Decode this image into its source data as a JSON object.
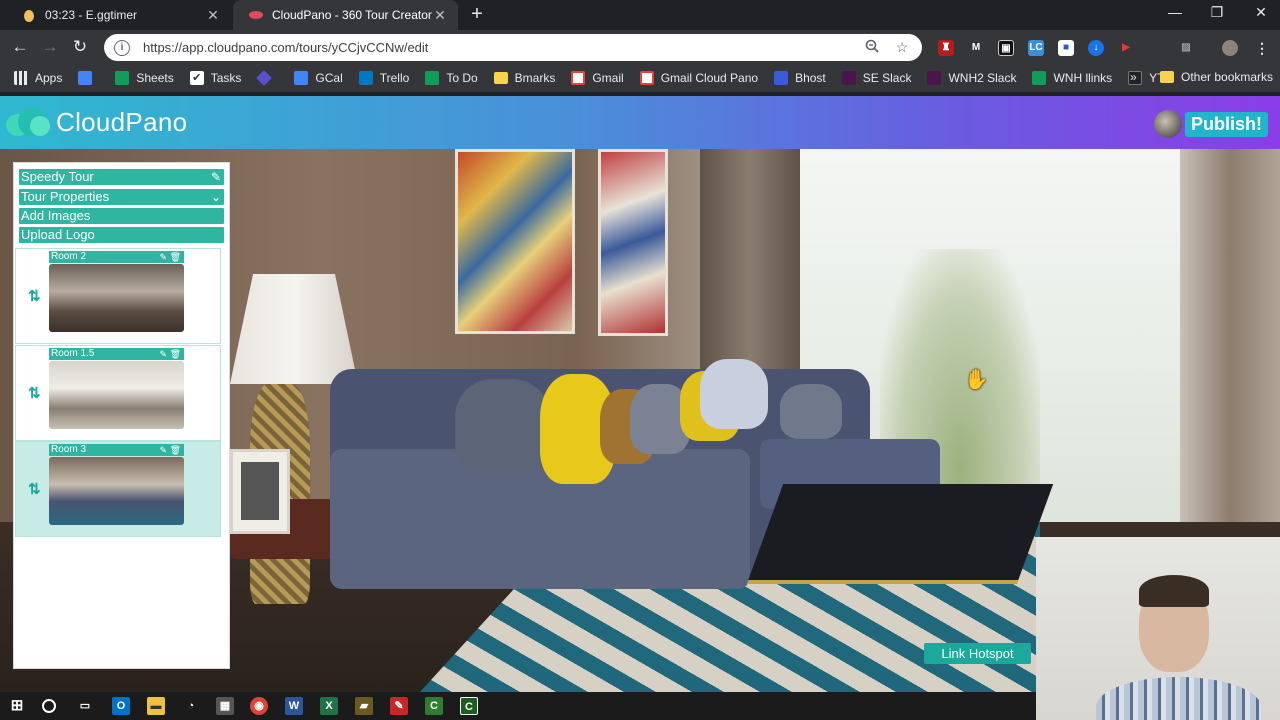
{
  "browser": {
    "tabs": [
      {
        "title": "03:23 - E.ggtimer",
        "icon": "egg-timer-icon",
        "active": false
      },
      {
        "title": "CloudPano - 360 Tour Creator",
        "icon": "cloudpano-icon",
        "active": true
      }
    ],
    "url": "https://app.cloudpano.com/tours/yCCjvCCNw/edit",
    "bookmarks": [
      {
        "label": "Apps",
        "icon": "apps-grid-icon",
        "color": "#e8eaed"
      },
      {
        "label": "",
        "icon": "docs-icon",
        "color": "#4285f4"
      },
      {
        "label": "Sheets",
        "icon": "sheets-icon",
        "color": "#0f9d58"
      },
      {
        "label": "Tasks",
        "icon": "tasks-check-icon",
        "color": "#e8eaed"
      },
      {
        "label": "",
        "icon": "diamond-icon",
        "color": "#5a4fcf"
      },
      {
        "label": "GCal",
        "icon": "calendar-icon",
        "color": "#4285f4"
      },
      {
        "label": "Trello",
        "icon": "trello-icon",
        "color": "#0079bf"
      },
      {
        "label": "To Do",
        "icon": "sheets-icon",
        "color": "#0f9d58"
      },
      {
        "label": "Bmarks",
        "icon": "folder-icon",
        "color": "#f9d34b"
      },
      {
        "label": "Gmail",
        "icon": "gmail-icon",
        "color": "#ea4335"
      },
      {
        "label": "Gmail Cloud Pano",
        "icon": "gmail-icon",
        "color": "#ea4335"
      },
      {
        "label": "Bhost",
        "icon": "bhost-icon",
        "color": "#3b5bdb"
      },
      {
        "label": "SE Slack",
        "icon": "slack-icon",
        "color": "#4a154b"
      },
      {
        "label": "WNH2 Slack",
        "icon": "slack-icon",
        "color": "#4a154b"
      },
      {
        "label": "WNH llinks",
        "icon": "sheets-icon",
        "color": "#0f9d58"
      },
      {
        "label": "YT",
        "icon": "yt-icon",
        "color": "#222222"
      }
    ],
    "more": "»",
    "other_bookmarks": "Other bookmarks"
  },
  "app": {
    "brand": "CloudPano",
    "publish_label": "Publish!",
    "menu": {
      "tour_name": "Speedy Tour",
      "properties": "Tour Properties",
      "add_images": "Add Images",
      "upload_logo": "Upload Logo"
    },
    "rooms": [
      {
        "name": "Room 2",
        "selected": false
      },
      {
        "name": "Room 1.5",
        "selected": false
      },
      {
        "name": "Room 3",
        "selected": true
      }
    ],
    "hotspot_button": "Link Hotspot"
  },
  "colors": {
    "accent": "#2fb5a0",
    "header_start": "#2fb9d0",
    "header_end": "#8b3de8"
  }
}
